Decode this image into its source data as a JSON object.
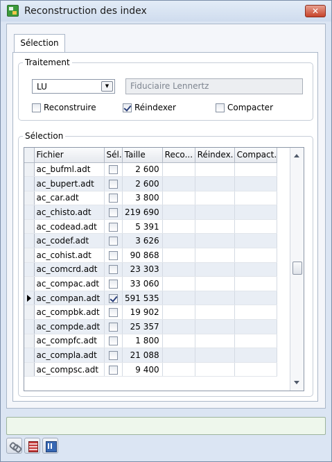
{
  "window": {
    "title": "Reconstruction des index",
    "close_label": "✕"
  },
  "tabs": [
    {
      "label": "Sélection",
      "active": true
    }
  ],
  "traitement": {
    "legend": "Traitement",
    "combo_value": "LU",
    "client_name": "Fiduciaire Lennertz",
    "options": [
      {
        "label": "Reconstruire",
        "checked": false
      },
      {
        "label": "Réindexer",
        "checked": true
      },
      {
        "label": "Compacter",
        "checked": false
      }
    ]
  },
  "selection": {
    "legend": "Sélection",
    "columns": [
      "Fichier",
      "Sél.",
      "Taille",
      "Reco...",
      "Réindex.",
      "Compact."
    ],
    "rows": [
      {
        "fichier": "ac_bufml.adt",
        "sel": false,
        "taille": "2 600",
        "current": false
      },
      {
        "fichier": "ac_bupert.adt",
        "sel": false,
        "taille": "2 600",
        "current": false
      },
      {
        "fichier": "ac_car.adt",
        "sel": false,
        "taille": "3 800",
        "current": false
      },
      {
        "fichier": "ac_chisto.adt",
        "sel": false,
        "taille": "219 690",
        "current": false
      },
      {
        "fichier": "ac_codead.adt",
        "sel": false,
        "taille": "5 391",
        "current": false
      },
      {
        "fichier": "ac_codef.adt",
        "sel": false,
        "taille": "3 626",
        "current": false
      },
      {
        "fichier": "ac_cohist.adt",
        "sel": false,
        "taille": "90 868",
        "current": false
      },
      {
        "fichier": "ac_comcrd.adt",
        "sel": false,
        "taille": "23 303",
        "current": false
      },
      {
        "fichier": "ac_compac.adt",
        "sel": false,
        "taille": "33 060",
        "current": false
      },
      {
        "fichier": "ac_compan.adt",
        "sel": true,
        "taille": "591 535",
        "current": true
      },
      {
        "fichier": "ac_compbk.adt",
        "sel": false,
        "taille": "19 902",
        "current": false
      },
      {
        "fichier": "ac_compde.adt",
        "sel": false,
        "taille": "25 357",
        "current": false
      },
      {
        "fichier": "ac_compfc.adt",
        "sel": false,
        "taille": "1 800",
        "current": false
      },
      {
        "fichier": "ac_compla.adt",
        "sel": false,
        "taille": "21 088",
        "current": false
      },
      {
        "fichier": "ac_compsc.adt",
        "sel": false,
        "taille": "9 400",
        "current": false
      }
    ]
  },
  "status": {
    "text": ""
  },
  "toolbar": {
    "icons": [
      "link-icon",
      "database-icon",
      "grid-icon"
    ]
  }
}
